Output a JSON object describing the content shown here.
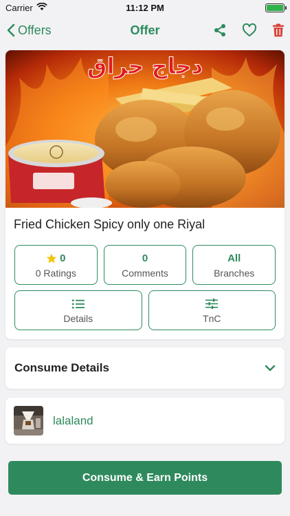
{
  "status_bar": {
    "carrier": "Carrier",
    "time": "11:12 PM",
    "battery": 1.0
  },
  "nav": {
    "back_label": "Offers",
    "title": "Offer",
    "actions": [
      "share-icon",
      "heart-icon",
      "trash-icon"
    ],
    "accent": "#2e8a5d",
    "delete_color": "#d9433a"
  },
  "offer": {
    "image_text": "دجاج حراق",
    "title": "Fried Chicken Spicy only one Riyal",
    "stats": [
      {
        "key": "ratings",
        "value": "0",
        "label": "0 Ratings",
        "icon": "star-icon"
      },
      {
        "key": "comments",
        "value": "0",
        "label": "Comments"
      },
      {
        "key": "branches",
        "value": "All",
        "label": "Branches"
      }
    ],
    "actions": [
      {
        "key": "details",
        "label": "Details",
        "icon": "list-icon"
      },
      {
        "key": "tnc",
        "label": "TnC",
        "icon": "sliders-icon"
      }
    ]
  },
  "consume": {
    "title": "Consume Details",
    "icon": "chevron-down-icon"
  },
  "merchant": {
    "name": "lalaland"
  },
  "cta": {
    "label": "Consume & Earn Points"
  },
  "colors": {
    "accent": "#2e8a5d",
    "background": "#f2f2f4",
    "star": "#f1c40f"
  }
}
